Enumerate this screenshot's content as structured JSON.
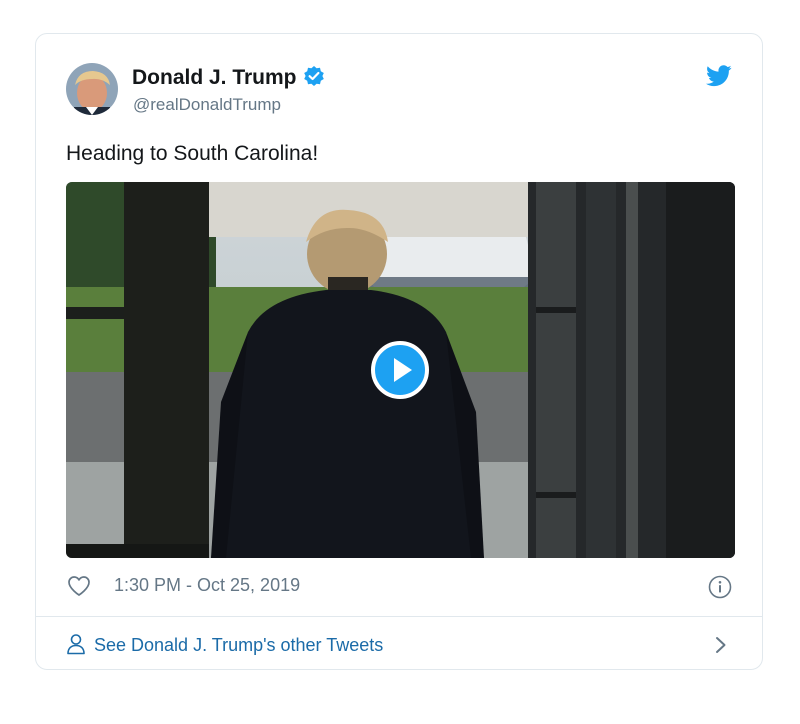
{
  "tweet": {
    "author_name": "Donald J. Trump",
    "author_handle": "@realDonaldTrump",
    "text": "Heading to South Carolina!",
    "timestamp": "1:30 PM - Oct 25, 2019"
  },
  "footer": {
    "more_tweets_label": "See Donald J. Trump's other Tweets"
  },
  "icons": {
    "verified": "verified-badge-icon",
    "brand": "twitter-bird-icon",
    "like": "heart-icon",
    "info": "info-icon",
    "person": "person-icon",
    "chevron": "chevron-right-icon",
    "play": "play-icon"
  },
  "colors": {
    "brand_blue": "#1da1f2",
    "link_blue": "#1b6ba8",
    "secondary_text": "#657786",
    "border": "#e1e8ed"
  }
}
